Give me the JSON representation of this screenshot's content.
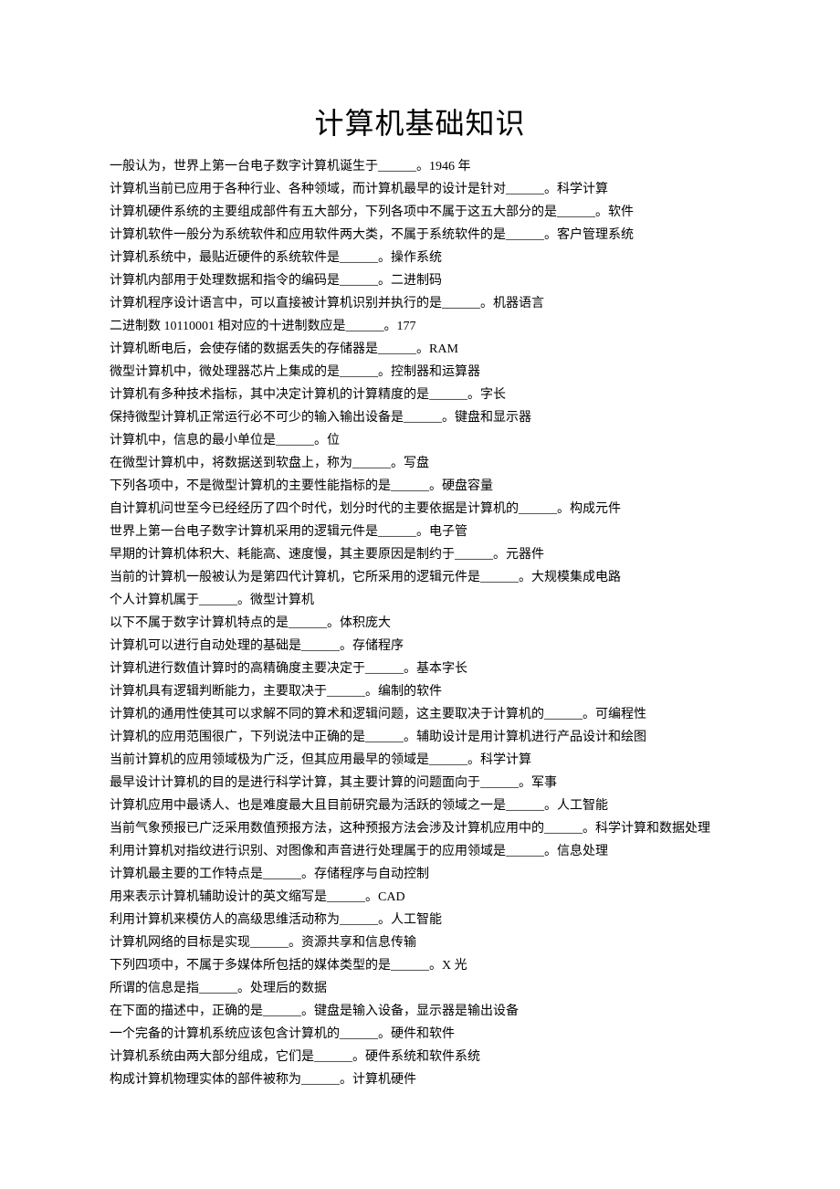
{
  "title": "计算机基础知识",
  "lines": [
    "一般认为，世界上第一台电子数字计算机诞生于______。1946 年",
    "计算机当前已应用于各种行业、各种领域，而计算机最早的设计是针对______。科学计算",
    "计算机硬件系统的主要组成部件有五大部分，下列各项中不属于这五大部分的是______。软件",
    "计算机软件一般分为系统软件和应用软件两大类，不属于系统软件的是______。客户管理系统",
    "计算机系统中，最贴近硬件的系统软件是______。操作系统",
    "计算机内部用于处理数据和指令的编码是______。二进制码",
    "计算机程序设计语言中，可以直接被计算机识别并执行的是______。机器语言",
    "二进制数 10110001 相对应的十进制数应是______。177",
    "计算机断电后，会使存储的数据丢失的存储器是______。RAM",
    "微型计算机中，微处理器芯片上集成的是______。控制器和运算器",
    "计算机有多种技术指标，其中决定计算机的计算精度的是______。字长",
    "保持微型计算机正常运行必不可少的输入输出设备是______。键盘和显示器",
    "计算机中，信息的最小单位是______。位",
    "在微型计算机中，将数据送到软盘上，称为______。写盘",
    "下列各项中，不是微型计算机的主要性能指标的是______。硬盘容量",
    "自计算机问世至今已经经历了四个时代，划分时代的主要依据是计算机的______。构成元件",
    "世界上第一台电子数字计算机采用的逻辑元件是______。电子管",
    "早期的计算机体积大、耗能高、速度慢，其主要原因是制约于______。元器件",
    "当前的计算机一般被认为是第四代计算机，它所采用的逻辑元件是______。大规模集成电路",
    "个人计算机属于______。微型计算机",
    "以下不属于数字计算机特点的是______。体积庞大",
    "计算机可以进行自动处理的基础是______。存储程序",
    "计算机进行数值计算时的高精确度主要决定于______。基本字长",
    "计算机具有逻辑判断能力，主要取决于______。编制的软件",
    "计算机的通用性使其可以求解不同的算术和逻辑问题，这主要取决于计算机的______。可编程性",
    "计算机的应用范围很广，下列说法中正确的是______。辅助设计是用计算机进行产品设计和绘图",
    "当前计算机的应用领域极为广泛，但其应用最早的领域是______。科学计算",
    "最早设计计算机的目的是进行科学计算，其主要计算的问题面向于______。军事",
    "计算机应用中最诱人、也是难度最大且目前研究最为活跃的领域之一是______。人工智能",
    "当前气象预报已广泛采用数值预报方法，这种预报方法会涉及计算机应用中的______。科学计算和数据处理",
    "利用计算机对指纹进行识别、对图像和声音进行处理属于的应用领域是______。信息处理",
    "计算机最主要的工作特点是______。存储程序与自动控制",
    "用来表示计算机辅助设计的英文缩写是______。CAD",
    "利用计算机来模仿人的高级思维活动称为______。人工智能",
    "计算机网络的目标是实现______。资源共享和信息传输",
    "下列四项中，不属于多媒体所包括的媒体类型的是______。X 光",
    "所谓的信息是指______。处理后的数据",
    "在下面的描述中，正确的是______。键盘是输入设备，显示器是输出设备",
    "一个完备的计算机系统应该包含计算机的______。硬件和软件",
    "计算机系统由两大部分组成，它们是______。硬件系统和软件系统",
    "构成计算机物理实体的部件被称为______。计算机硬件"
  ]
}
